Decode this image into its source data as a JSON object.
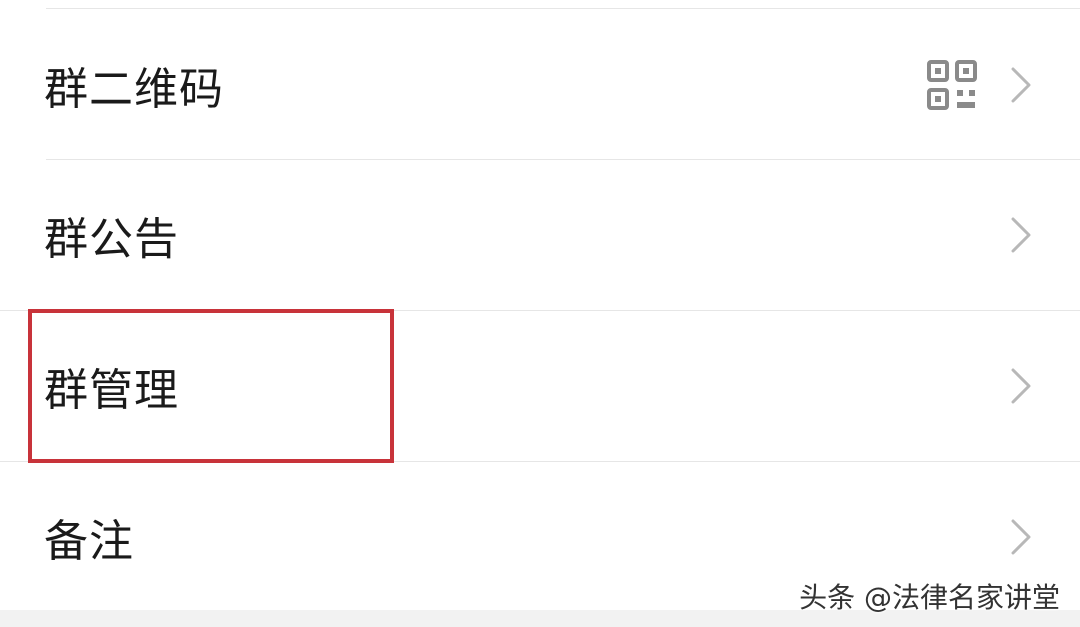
{
  "settings_list": {
    "items": [
      {
        "label": "群二维码",
        "has_qr_icon": true
      },
      {
        "label": "群公告",
        "has_qr_icon": false
      },
      {
        "label": "群管理",
        "has_qr_icon": false,
        "highlighted": true
      },
      {
        "label": "备注",
        "has_qr_icon": false
      }
    ]
  },
  "icons": {
    "qr": "qr-code-icon",
    "chevron": "chevron-right-icon"
  },
  "colors": {
    "highlight_border": "#c8333a",
    "chevron": "#b8b8b8",
    "icon": "#8a8a8a"
  },
  "watermark": {
    "text": "头条 @法律名家讲堂"
  }
}
